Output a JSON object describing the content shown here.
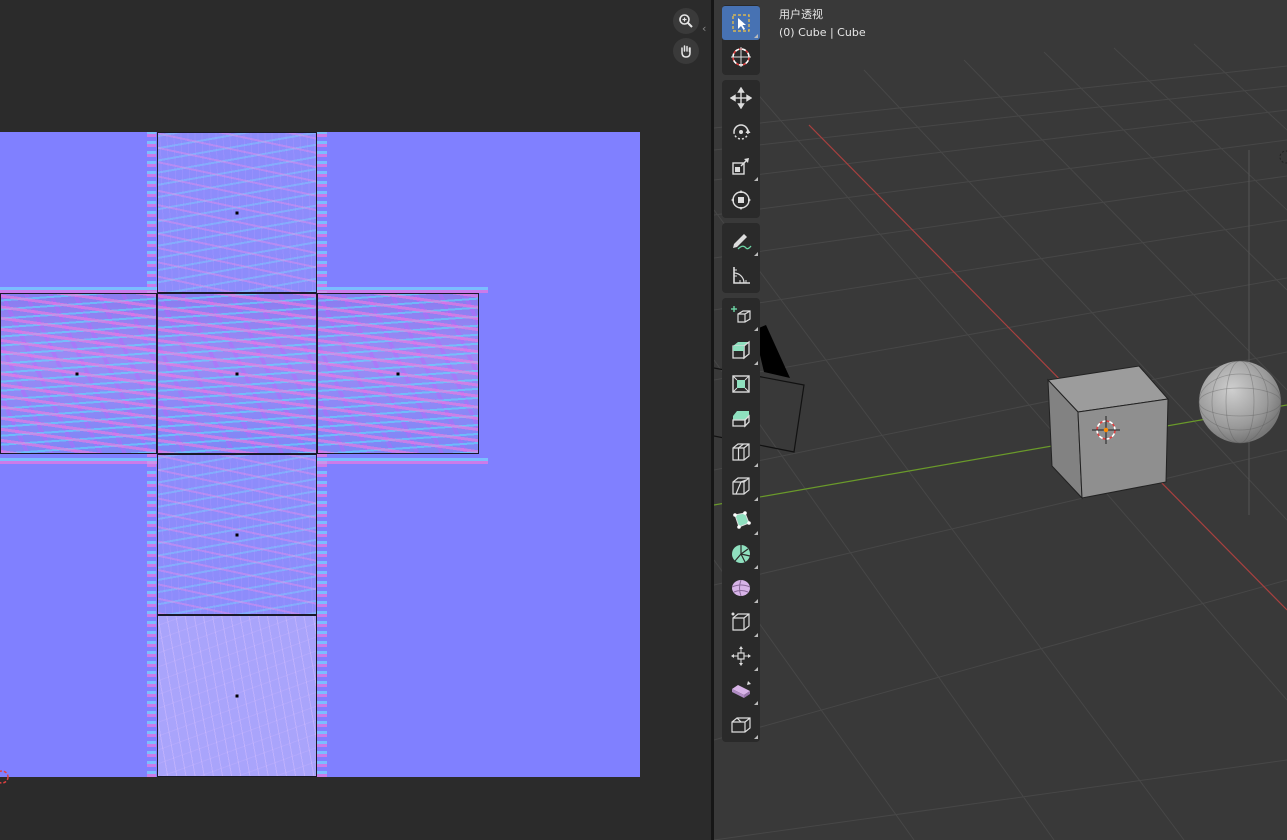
{
  "viewport": {
    "view_name": "用户透视",
    "object_info": "(0) Cube | Cube"
  },
  "uv_editor": {
    "tools": [
      {
        "name": "zoom-icon"
      },
      {
        "name": "hand-pan-icon"
      }
    ]
  },
  "toolbar": {
    "groups": [
      [
        "select-box-icon",
        "cursor-icon"
      ],
      [
        "move-icon",
        "rotate-icon",
        "scale-icon",
        "transform-icon"
      ],
      [
        "annotate-icon",
        "measure-icon"
      ],
      [
        "add-cube-icon",
        "extrude-region-icon",
        "inset-faces-icon",
        "bevel-icon",
        "loop-cut-icon",
        "knife-icon",
        "poly-build-icon",
        "spin-icon",
        "smooth-icon",
        "edge-slide-icon",
        "shrink-fatten-icon",
        "shear-icon",
        "rip-region-icon"
      ]
    ]
  },
  "colors": {
    "active_tool": "#4772b3",
    "uv_background": "#8080ff",
    "x_axis": "#b03a3a",
    "y_axis": "#6a9a2a"
  }
}
